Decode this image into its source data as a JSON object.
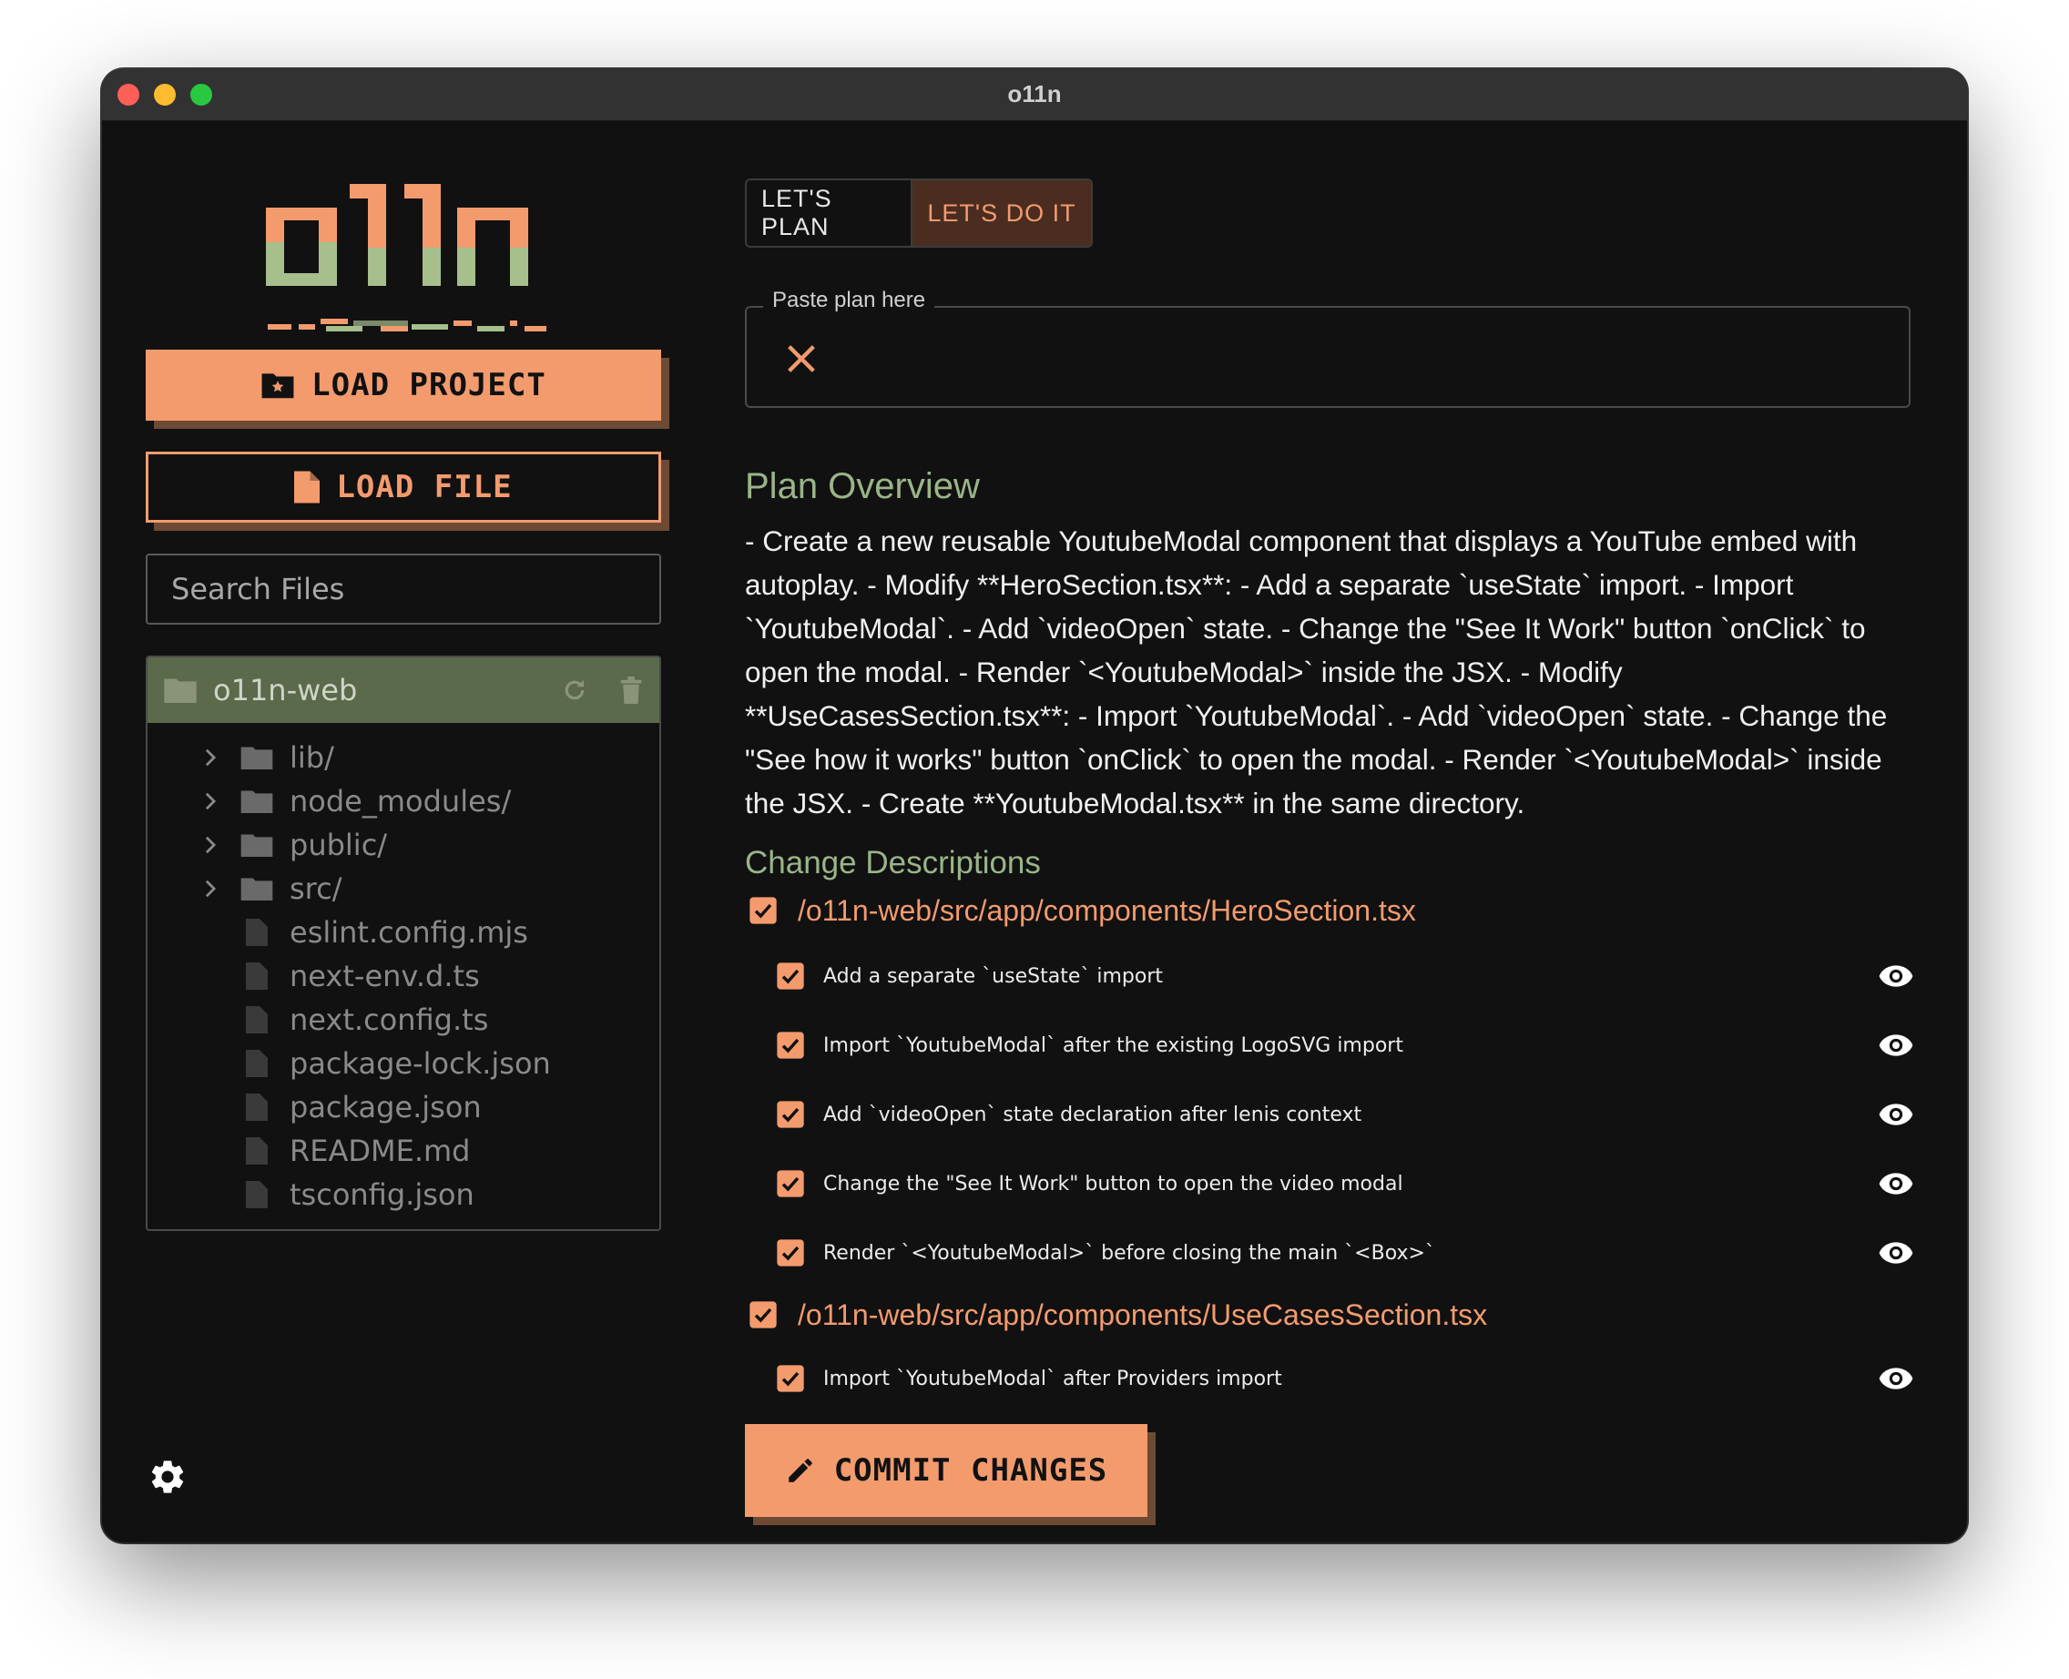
{
  "window": {
    "title": "o11n"
  },
  "logo": {
    "text": "o11n"
  },
  "sidebar": {
    "load_project_label": "LOAD PROJECT",
    "load_file_label": "LOAD FILE",
    "search_placeholder": "Search Files",
    "project": {
      "name": "o11n-web",
      "items": [
        {
          "label": "lib/",
          "type": "folder"
        },
        {
          "label": "node_modules/",
          "type": "folder"
        },
        {
          "label": "public/",
          "type": "folder"
        },
        {
          "label": "src/",
          "type": "folder"
        },
        {
          "label": "eslint.config.mjs",
          "type": "file"
        },
        {
          "label": "next-env.d.ts",
          "type": "file"
        },
        {
          "label": "next.config.ts",
          "type": "file"
        },
        {
          "label": "package-lock.json",
          "type": "file"
        },
        {
          "label": "package.json",
          "type": "file"
        },
        {
          "label": "README.md",
          "type": "file"
        },
        {
          "label": "tsconfig.json",
          "type": "file"
        }
      ]
    }
  },
  "tabs": {
    "plan_label": "LET'S PLAN",
    "do_label": "LET'S DO IT",
    "active": "do"
  },
  "paste": {
    "label": "Paste plan here"
  },
  "overview": {
    "heading": "Plan Overview",
    "text": "- Create a new reusable YoutubeModal component that displays a YouTube embed with autoplay. - Modify **HeroSection.tsx**: - Add a separate `useState` import. - Import `YoutubeModal`. - Add `videoOpen` state. - Change the \"See It Work\" button `onClick` to open the modal. - Render `<YoutubeModal>` inside the JSX. - Modify **UseCasesSection.tsx**: - Import `YoutubeModal`. - Add `videoOpen` state. - Change the \"See how it works\" button `onClick` to open the modal. - Render `<YoutubeModal>` inside the JSX. - Create **YoutubeModal.tsx** in the same directory."
  },
  "changes": {
    "heading": "Change Descriptions",
    "files": [
      {
        "path": "/o11n-web/src/app/components/HeroSection.tsx",
        "checked": true,
        "items": [
          {
            "text": "Add a separate `useState` import",
            "checked": true
          },
          {
            "text": "Import `YoutubeModal` after the existing LogoSVG import",
            "checked": true
          },
          {
            "text": "Add `videoOpen` state declaration after lenis context",
            "checked": true
          },
          {
            "text": "Change the \"See It Work\" button to open the video modal",
            "checked": true
          },
          {
            "text": "Render `<YoutubeModal>` before closing the main `<Box>`",
            "checked": true
          }
        ]
      },
      {
        "path": "/o11n-web/src/app/components/UseCasesSection.tsx",
        "checked": true,
        "items": [
          {
            "text": "Import `YoutubeModal` after Providers import",
            "checked": true
          }
        ]
      }
    ]
  },
  "commit_label": "COMMIT CHANGES",
  "colors": {
    "accent": "#f39b6d",
    "accent_shadow": "#6d4a36",
    "green": "#9ab587",
    "folder_header": "#5a6a4a",
    "background": "#111111"
  },
  "icons": {
    "load_project": "folder-star-icon",
    "load_file": "file-icon",
    "refresh": "refresh-icon",
    "delete": "trash-icon",
    "settings": "gear-icon",
    "clear": "close-icon",
    "view": "eye-icon",
    "commit": "pencil-icon"
  }
}
